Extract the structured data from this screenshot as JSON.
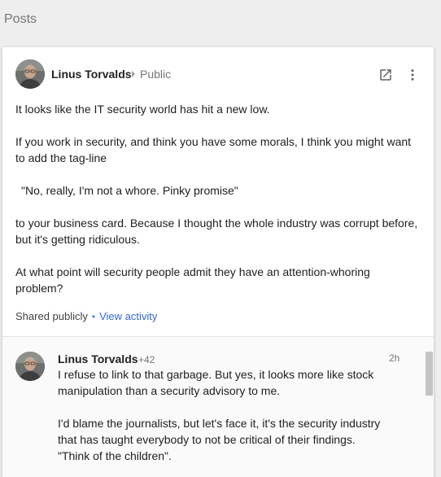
{
  "section": {
    "title": "Posts"
  },
  "post": {
    "author": "Linus Torvalds",
    "visibility": "Public",
    "header_icons": [
      "open-in-new-icon",
      "more-vert-icon"
    ],
    "paragraphs": [
      "It looks like the IT security world has hit a new low.",
      "If you work in security, and think you have some morals, I think you might want to add the tag-line",
      "\"No, really, I'm not a whore. Pinky promise\"",
      "to your business card. Because I thought the whole industry was corrupt before, but it's getting ridiculous.",
      "At what point will security people admit they have an attention-whoring problem?"
    ],
    "shared_label": "Shared publicly",
    "separator": "•",
    "activity_link": "View activity"
  },
  "comment": {
    "author": "Linus Torvalds",
    "plus_count": "+42",
    "timestamp": "2h",
    "paragraphs": [
      "I refuse to link to that garbage. But yes, it looks more like stock manipulation than a security advisory to me.",
      "I'd blame the journalists, but let's face it, it's the security industry that has taught everybody to not be critical of their findings. \"Think of the children\"."
    ]
  },
  "colors": {
    "page_background": "#eeeeee",
    "card_background": "#ffffff",
    "link": "#3367d6",
    "muted_text": "#757575"
  }
}
